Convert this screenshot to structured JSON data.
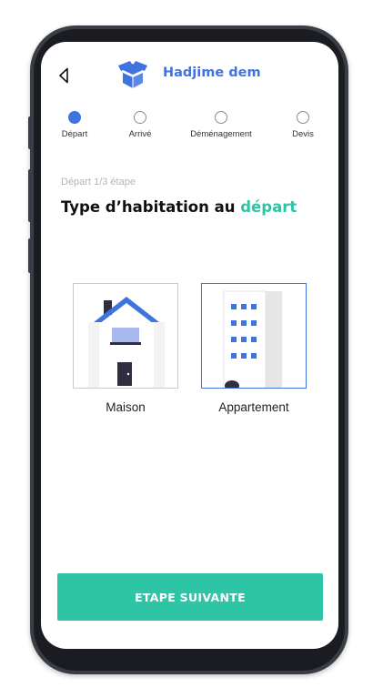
{
  "header": {
    "brand": "Hadjime dem",
    "back_icon": "chevron-left-icon",
    "logo_icon": "box-logo-icon",
    "brand_color": "#3f73e0"
  },
  "stepper": {
    "steps": [
      {
        "label": "Départ",
        "active": true
      },
      {
        "label": "Arrivé",
        "active": false
      },
      {
        "label": "Déménagement",
        "active": false
      },
      {
        "label": "Devis",
        "active": false
      }
    ]
  },
  "content": {
    "step_counter": "Départ 1/3 étape",
    "title_prefix": "Type d’habitation au ",
    "title_accent": "départ",
    "accent_color": "#2ec4a6"
  },
  "options": [
    {
      "label": "Maison",
      "icon": "house-icon",
      "selected": false
    },
    {
      "label": "Appartement",
      "icon": "apartment-building-icon",
      "selected": true
    }
  ],
  "cta": {
    "label": "ETAPE SUIVANTE",
    "color": "#2ec4a6"
  }
}
